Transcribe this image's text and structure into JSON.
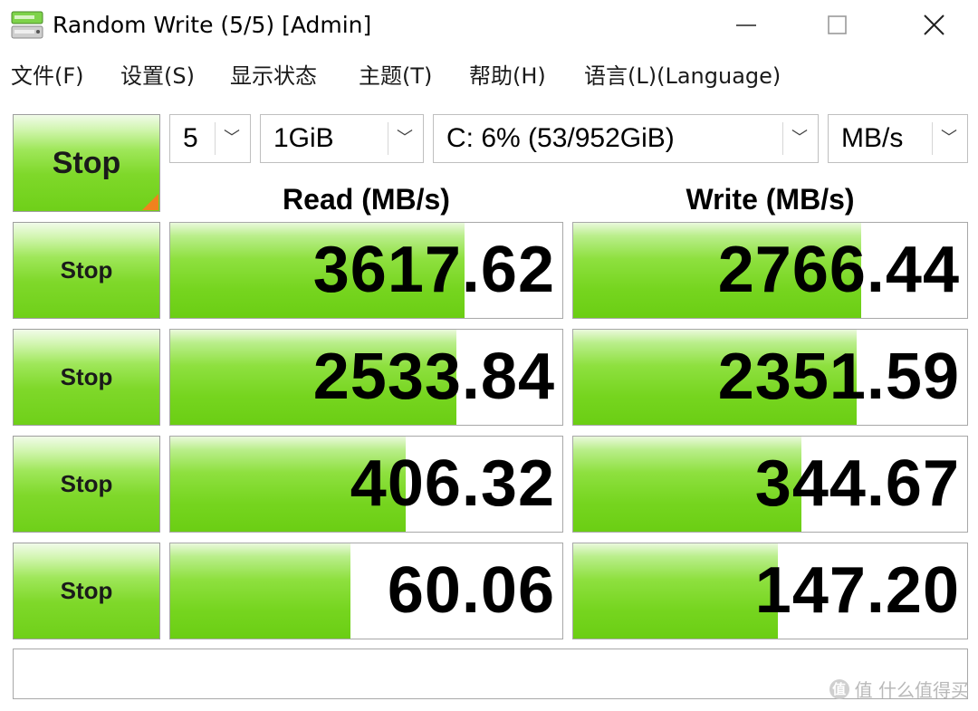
{
  "window": {
    "title": "Random Write (5/5) [Admin]",
    "controls": {
      "minimize": "—",
      "maximize": "☐",
      "close": "✕"
    }
  },
  "menu": [
    "文件(F)",
    "设置(S)",
    "显示状态",
    "主题(T)",
    "帮助(H)",
    "语言(L)(Language)"
  ],
  "toolbar": {
    "all_button": "Stop",
    "count": "5",
    "size": "1GiB",
    "drive": "C: 6% (53/952GiB)",
    "unit": "MB/s",
    "chevron": "﹀"
  },
  "headers": {
    "read": "Read (MB/s)",
    "write": "Write (MB/s)"
  },
  "rows": [
    {
      "button": "Stop",
      "read": "3617.62",
      "write": "2766.44",
      "read_fill": 0.75,
      "write_fill": 0.73
    },
    {
      "button": "Stop",
      "read": "2533.84",
      "write": "2351.59",
      "read_fill": 0.73,
      "write_fill": 0.72
    },
    {
      "button": "Stop",
      "read": "406.32",
      "write": "344.67",
      "read_fill": 0.6,
      "write_fill": 0.58
    },
    {
      "button": "Stop",
      "read": "60.06",
      "write": "147.20",
      "read_fill": 0.46,
      "write_fill": 0.52
    }
  ],
  "comment": "",
  "watermark": "值 什么值得买",
  "watermark_icon": "值"
}
